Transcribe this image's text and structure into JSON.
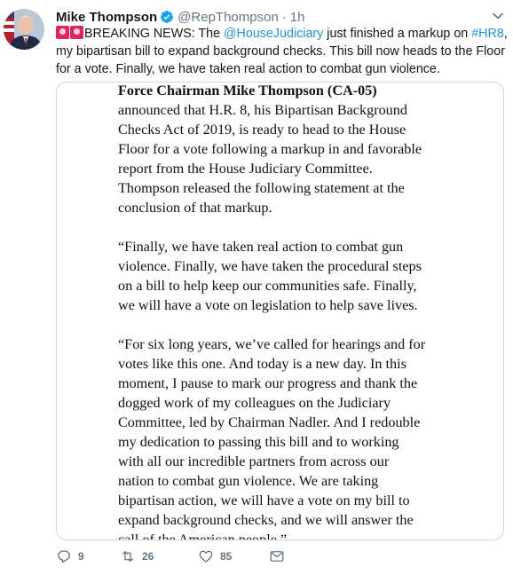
{
  "tweet": {
    "author_name": "Mike Thompson",
    "handle": "@RepThompson",
    "separator": "·",
    "time": "1h",
    "text_line1_a": "BREAKING NEWS: The ",
    "mention": "@HouseJudiciary",
    "text_line1_b": " just finished a markup on ",
    "hashtag": "#HR8",
    "text_line1_c": ",",
    "text_line2": "my bipartisan bill to expand background checks. This bill now heads to the Floor",
    "text_line3": "for a vote. Finally, we have taken real action to combat gun violence."
  },
  "document": {
    "p1_bold": "Force Chairman Mike Thompson (CA-05)",
    "p1_lines": [
      "announced that H.R. 8, his Bipartisan Background",
      "Checks Act of 2019, is ready to head to the House",
      "Floor for a vote following a markup in and favorable",
      "report from the House Judiciary Committee.",
      "Thompson released the following statement at the",
      "conclusion of that markup."
    ],
    "p2_lines": [
      "“Finally, we have taken real action to combat gun",
      "violence. Finally, we have taken the procedural steps",
      "on a bill to help keep our communities safe. Finally,",
      "we will have a vote on legislation to help save lives."
    ],
    "p3_lines": [
      "“For six long years, we’ve called for hearings and for",
      "votes like this one. And today is a new day. In this",
      "moment, I pause to mark our progress and thank the",
      "dogged work of my colleagues on the Judiciary",
      "Committee, led by Chairman Nadler. And I redouble",
      "my dedication to passing this bill and to working",
      "with all our incredible partners from across our",
      "nation to combat gun violence. We are taking",
      "bipartisan action, we will have a vote on my bill to",
      "expand background checks, and we will answer the",
      "call of the American people.”"
    ]
  },
  "actions": {
    "replies": "9",
    "retweets": "26",
    "likes": "85"
  },
  "colors": {
    "link": "#1b95e0",
    "muted": "#657786",
    "alert_emoji": "#e0245e"
  },
  "icons": [
    "verified-badge-icon",
    "caret-down-icon",
    "rotating-light-emoji",
    "reply-icon",
    "retweet-icon",
    "like-icon",
    "direct-message-icon"
  ]
}
